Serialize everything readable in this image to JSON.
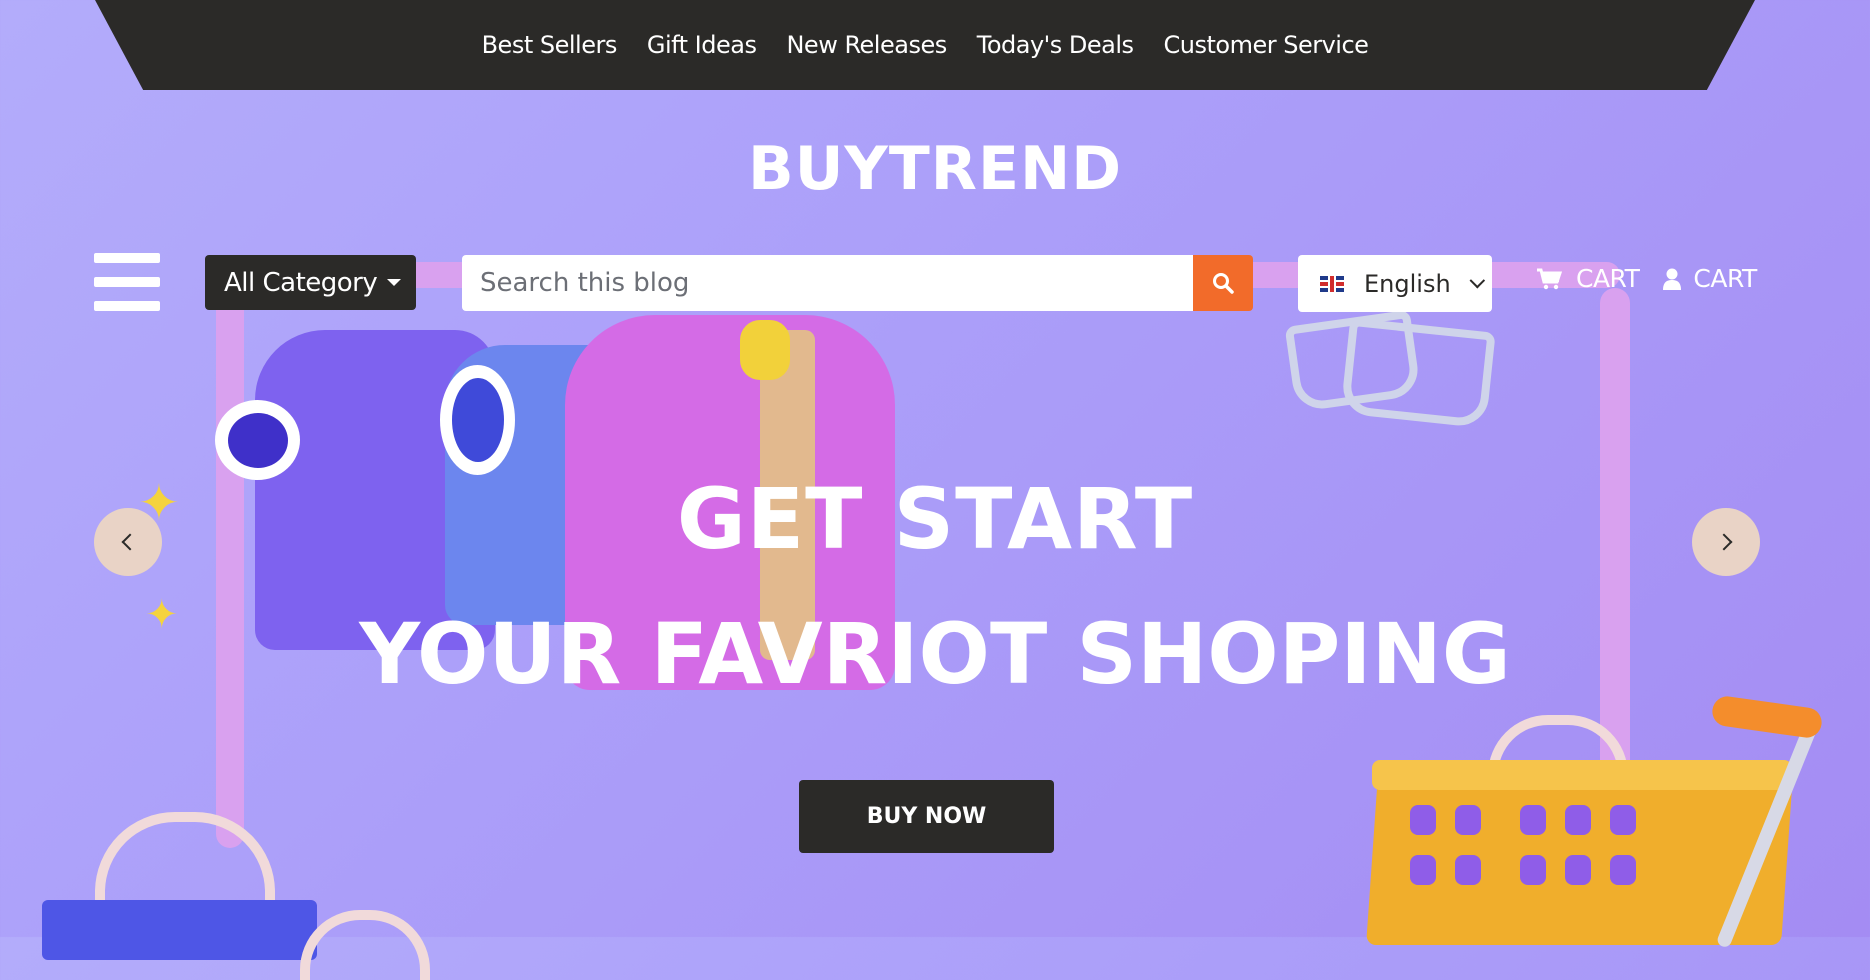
{
  "topnav": {
    "items": [
      {
        "label": "Best Sellers"
      },
      {
        "label": "Gift Ideas"
      },
      {
        "label": "New Releases"
      },
      {
        "label": "Today's Deals"
      },
      {
        "label": "Customer Service"
      }
    ]
  },
  "brand": {
    "name": "BUYTREND"
  },
  "header": {
    "menu_icon": "hamburger-menu-icon",
    "category_button": "All Category",
    "search_placeholder": "Search this blog",
    "search_icon": "search-icon",
    "language": "English",
    "cart_label": "CART",
    "account_label": "CART"
  },
  "hero": {
    "line1": "GET START",
    "line2": "YOUR FAVRIOT SHOPING",
    "cta": "BUY NOW"
  },
  "colors": {
    "dark": "#2b2a28",
    "accent": "#f26b2a",
    "background": "#ab9ef9"
  }
}
